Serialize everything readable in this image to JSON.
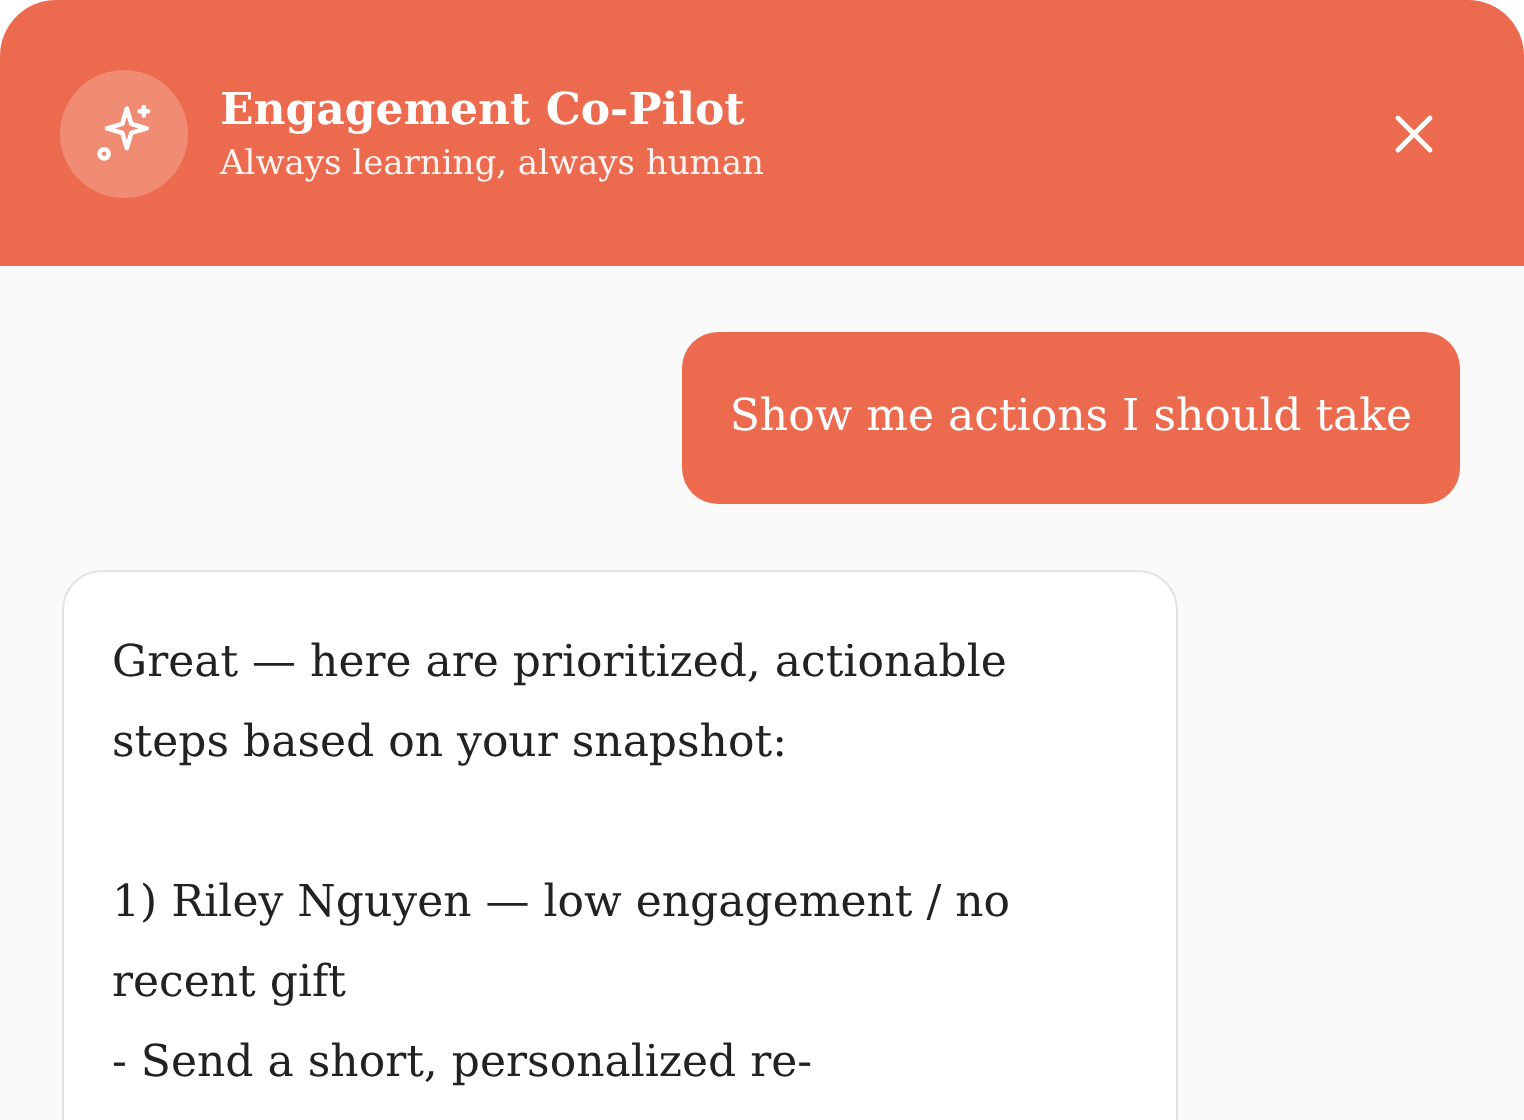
{
  "header": {
    "title": "Engagement Co-Pilot",
    "subtitle": "Always learning, always human"
  },
  "messages": [
    {
      "kind": "outgoing",
      "text": "Show me actions I should take"
    },
    {
      "kind": "incoming",
      "text": "Great — here are prioritized, actionable steps based on your snapshot:\n\n1) Riley Nguyen — low engagement / no recent gift\n- Send a short, personalized re-"
    }
  ]
}
